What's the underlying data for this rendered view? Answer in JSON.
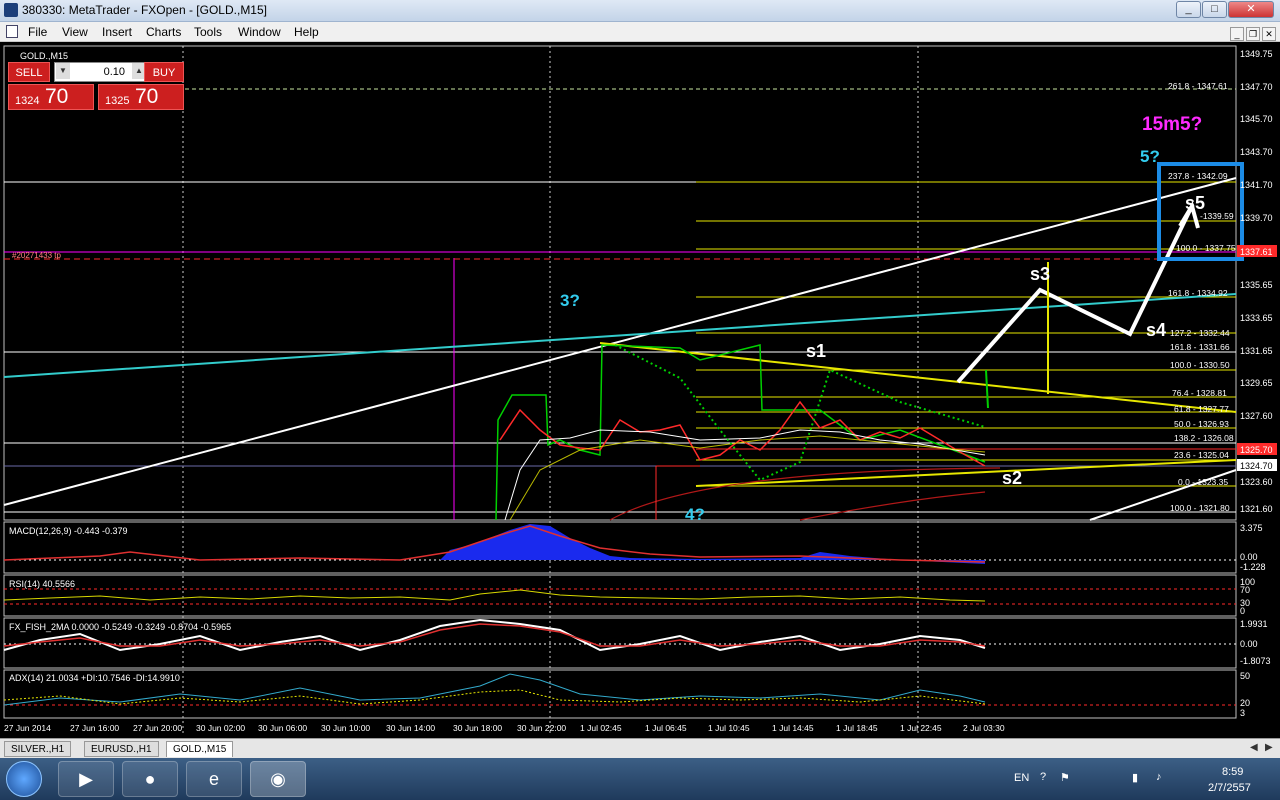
{
  "window": {
    "title": "380330: MetaTrader - FXOpen - [GOLD.,M15]",
    "minimize": "_",
    "maximize": "□",
    "close": "✕"
  },
  "menu": [
    "File",
    "View",
    "Insert",
    "Charts",
    "Tools",
    "Window",
    "Help"
  ],
  "chart": {
    "symbol_label": "GOLD.,M15",
    "order_label": "#20271433 tp",
    "price_axis": [
      "1349.75",
      "1347.70",
      "1345.70",
      "1343.70",
      "1341.70",
      "1339.70",
      "1335.65",
      "1333.65",
      "1331.65",
      "1329.65",
      "1327.60",
      "1323.60",
      "1321.60"
    ],
    "current_price": "1324.70",
    "red_price": "1325.70",
    "tp_price": "1337.61",
    "fib_upper": [
      "261.8 - 1347.61",
      "237.8 - 1342.09",
      "-1339.59",
      "100.0 - 1337.75",
      "161.8 - 1334.92"
    ],
    "fib_lower": [
      "127.2 - 1332.44",
      "161.8 - 1331.66",
      "100.0 - 1330.50",
      "76.4 - 1328.81",
      "61.8 - 1327.77",
      "50.0 - 1326.93",
      "138.2 - 1326.08",
      "23.6 - 1325.04",
      "0.0 - 1323.35",
      "100.0 - 1321.80"
    ],
    "annotations": {
      "wave_15m5": "15m5?",
      "wave_5": "5?",
      "wave_3": "3?",
      "wave_4": "4?",
      "s1": "s1",
      "s2": "s2",
      "s3": "s3",
      "s4": "s4",
      "s5": "s5"
    },
    "time_axis": [
      "27 Jun 2014",
      "27 Jun 16:00",
      "27 Jun 20:00",
      "30 Jun 02:00",
      "30 Jun 06:00",
      "30 Jun 10:00",
      "30 Jun 14:00",
      "30 Jun 18:00",
      "30 Jun 22:00",
      "1 Jul 02:45",
      "1 Jul 06:45",
      "1 Jul 10:45",
      "1 Jul 14:45",
      "1 Jul 18:45",
      "1 Jul 22:45",
      "2 Jul 03:30"
    ]
  },
  "indicators": {
    "macd": {
      "label": "MACD(12,26,9) -0.443 -0.379",
      "axis": [
        "3.375",
        "0.00",
        "-1.228"
      ]
    },
    "rsi": {
      "label": "RSI(14) 40.5566",
      "axis": [
        "100",
        "70",
        "30",
        "0"
      ]
    },
    "fish": {
      "label": "FX_FISH_2MA 0.0000 -0.5249 -0.3249 -0.8704 -0.5965",
      "axis": [
        "1.9931",
        "0.00",
        "-1.8073"
      ]
    },
    "adx": {
      "label": "ADX(14) 21.0034 +DI:10.7546 -DI:14.9910",
      "axis": [
        "50",
        "20",
        "3"
      ]
    }
  },
  "trade_panel": {
    "sell_label": "SELL",
    "buy_label": "BUY",
    "lot": "0.10",
    "sell_small": "1324",
    "sell_big": "70",
    "buy_small": "1325",
    "buy_big": "70"
  },
  "tabs": [
    "SILVER.,H1",
    "EURUSD.,H1",
    "GOLD.,M15"
  ],
  "active_tab": "GOLD.,M15",
  "tray": {
    "lang": "EN",
    "time": "8:59",
    "date": "2/7/2557"
  },
  "colors": {
    "fib": "#e6e600",
    "trendline": "#ffffff",
    "channel": "#33cccc",
    "magenta": "#ff00ff",
    "label_cyan": "#33ccee",
    "order_red": "#ff2a2a"
  },
  "icons": [
    "app-icon",
    "start-icon",
    "media-player-icon",
    "chrome-icon",
    "ie-icon",
    "metatrader-icon",
    "help-icon",
    "network-icon",
    "volume-icon",
    "flag-icon"
  ]
}
